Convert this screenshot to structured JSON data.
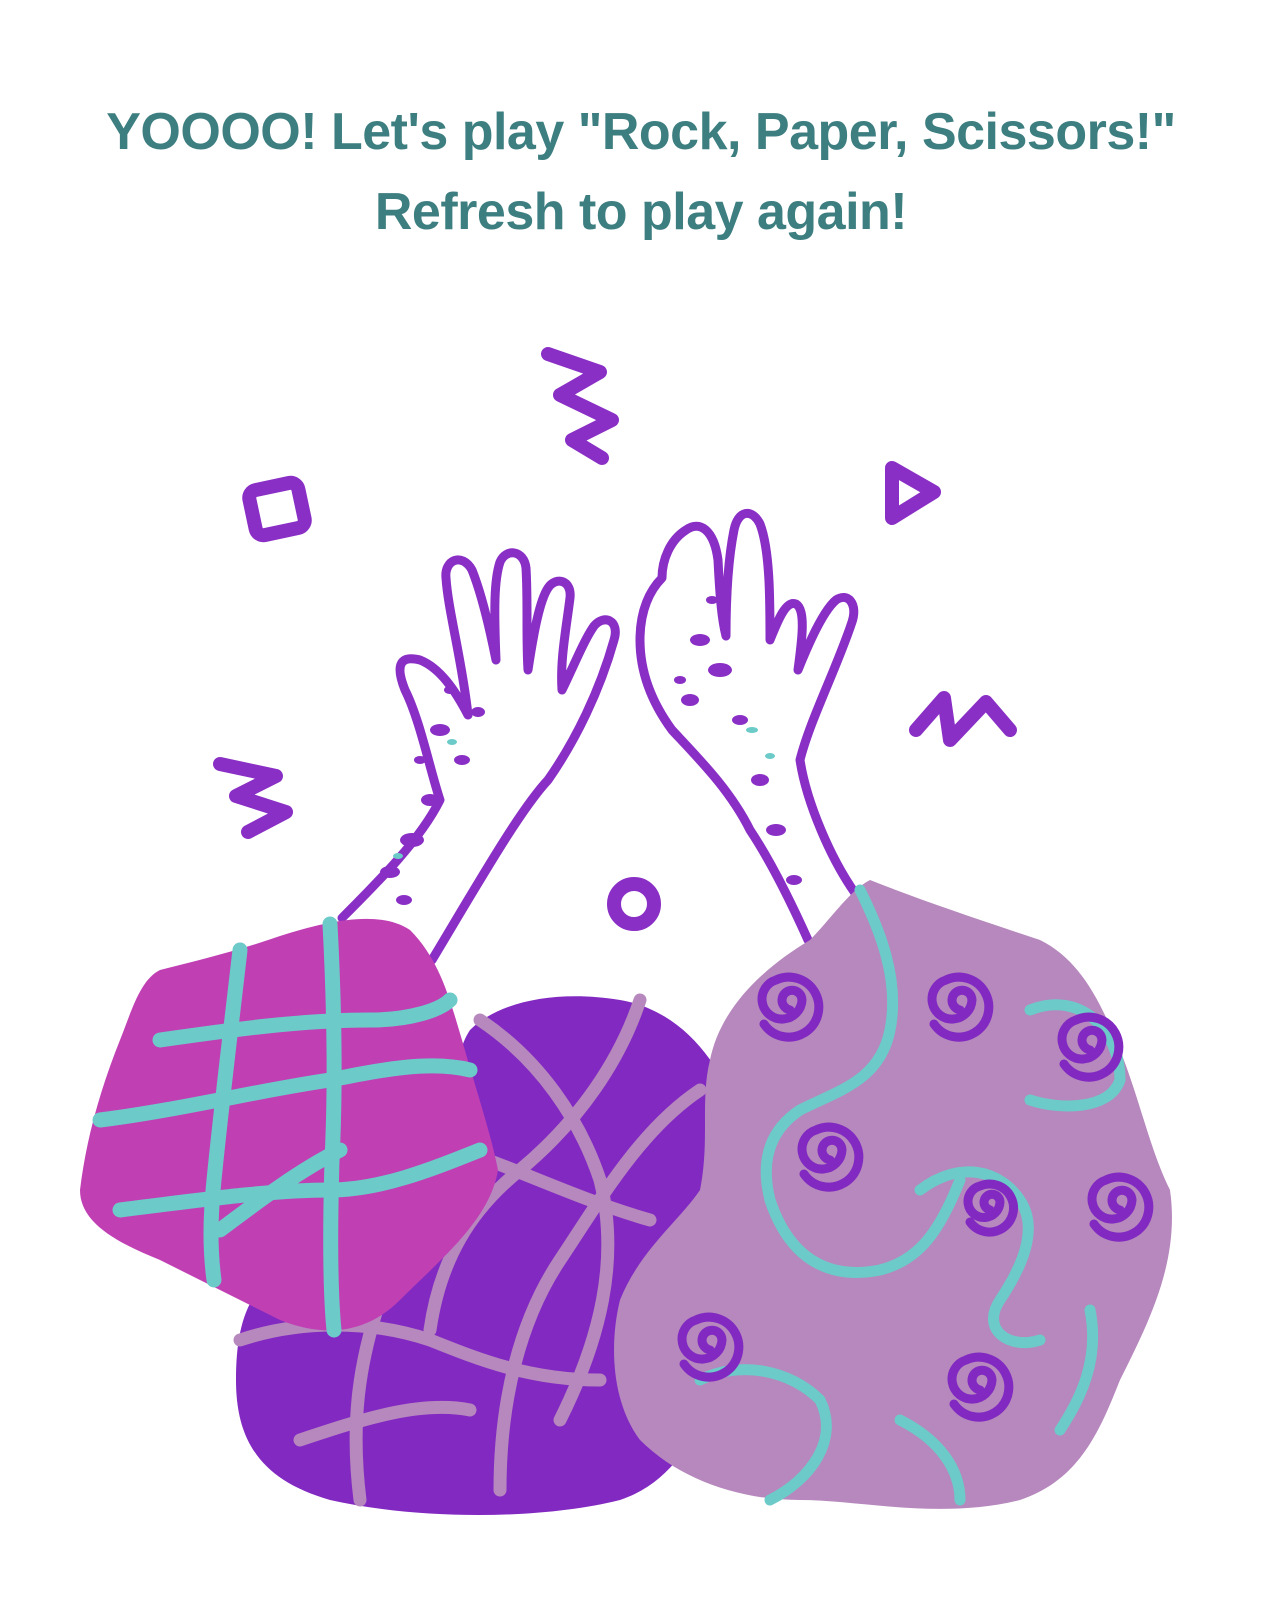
{
  "heading": {
    "line1": "YOOOO! Let's play \"Rock, Paper, Scissors!\"",
    "line2": "Refresh to play again!"
  },
  "illustration": {
    "subject": "hands-raised-over-three-patterned-rocks",
    "colors": {
      "heading_text": "#3d7e80",
      "magenta_rock": "#c040b4",
      "purple_rock": "#8229c2",
      "lilac_rock": "#b688bd",
      "teal_pattern": "#6ccbc8",
      "hand_outline": "#8a2fc5"
    }
  }
}
